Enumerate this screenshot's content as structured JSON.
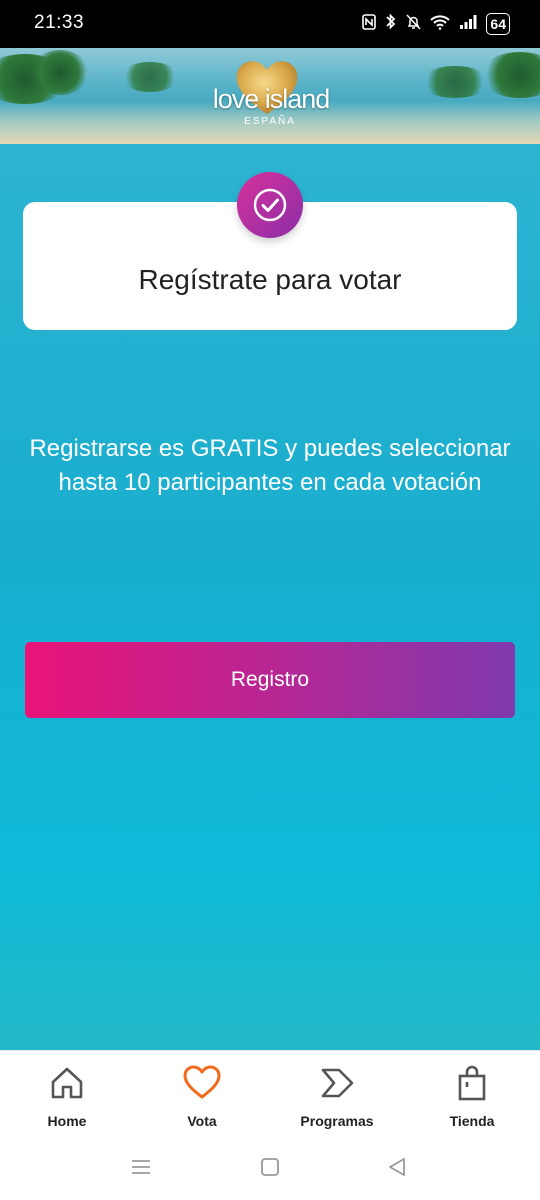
{
  "status_bar": {
    "time": "21:33",
    "battery": "64",
    "icons": [
      "nfc-icon",
      "bluetooth-icon",
      "mute-bell-icon",
      "wifi-icon",
      "signal-icon",
      "battery-icon"
    ]
  },
  "header": {
    "logo_text": "love island",
    "logo_subtitle": "ESPAÑA"
  },
  "card": {
    "title": "Regístrate para votar",
    "badge_icon": "check-icon"
  },
  "info": {
    "line1": "Registrarse es GRATIS y puedes seleccionar",
    "line2": "hasta 10 participantes en cada votación"
  },
  "register_button": {
    "label": "Registro",
    "gradient": [
      "#ea1479",
      "#7f3aae"
    ]
  },
  "bottom_nav": {
    "items": [
      {
        "label": "Home",
        "icon": "home-icon",
        "active": false
      },
      {
        "label": "Vota",
        "icon": "heart-icon",
        "active": true
      },
      {
        "label": "Programas",
        "icon": "play-icon",
        "active": false
      },
      {
        "label": "Tienda",
        "icon": "shopping-bag-icon",
        "active": false
      }
    ],
    "active_color": "#f26b1d",
    "inactive_color": "#555555"
  },
  "system_nav": {
    "icons": [
      "menu-icon",
      "home-square-icon",
      "back-icon"
    ]
  }
}
